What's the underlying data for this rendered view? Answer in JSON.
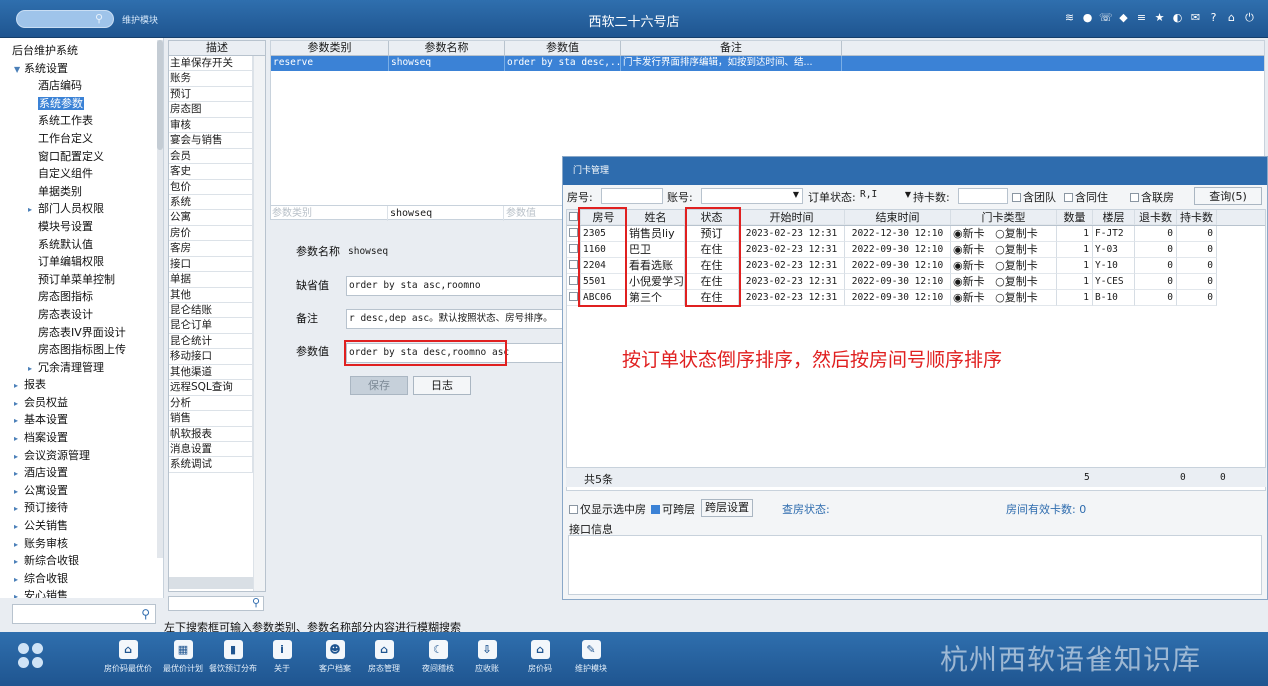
{
  "top_bar": {
    "search_icon": "search-icon",
    "module_label": "维护模块",
    "hotel_title": "西软二十六号店",
    "icons": [
      "wifi-icon",
      "message-icon",
      "phone-icon",
      "user-icon",
      "menu-icon",
      "star-icon",
      "contrast-icon",
      "mail-icon",
      "help-icon",
      "home-icon",
      "power-icon"
    ]
  },
  "nav": {
    "items": [
      {
        "label": "后台维护系统",
        "level": 0,
        "arrow": ""
      },
      {
        "label": "系统设置",
        "level": 1,
        "arrow": "▼"
      },
      {
        "label": "酒店编码",
        "level": 2,
        "arrow": ""
      },
      {
        "label": "系统参数",
        "level": 2,
        "arrow": "",
        "selected": true
      },
      {
        "label": "系统工作表",
        "level": 2,
        "arrow": ""
      },
      {
        "label": "工作台定义",
        "level": 2,
        "arrow": ""
      },
      {
        "label": "窗口配置定义",
        "level": 2,
        "arrow": ""
      },
      {
        "label": "自定义组件",
        "level": 2,
        "arrow": ""
      },
      {
        "label": "单据类别",
        "level": 2,
        "arrow": ""
      },
      {
        "label": "部门人员权限",
        "level": 2,
        "arrow": "▸"
      },
      {
        "label": "模块号设置",
        "level": 2,
        "arrow": ""
      },
      {
        "label": "系统默认值",
        "level": 2,
        "arrow": ""
      },
      {
        "label": "订单编辑权限",
        "level": 2,
        "arrow": ""
      },
      {
        "label": "预订单菜单控制",
        "level": 2,
        "arrow": ""
      },
      {
        "label": "房态图指标",
        "level": 2,
        "arrow": ""
      },
      {
        "label": "房态表设计",
        "level": 2,
        "arrow": ""
      },
      {
        "label": "房态表IV界面设计",
        "level": 2,
        "arrow": ""
      },
      {
        "label": "房态图指标图上传",
        "level": 2,
        "arrow": ""
      },
      {
        "label": "冗余清理管理",
        "level": 2,
        "arrow": "▸"
      },
      {
        "label": "报表",
        "level": 1,
        "arrow": "▸"
      },
      {
        "label": "会员权益",
        "level": 1,
        "arrow": "▸"
      },
      {
        "label": "基本设置",
        "level": 1,
        "arrow": "▸"
      },
      {
        "label": "档案设置",
        "level": 1,
        "arrow": "▸"
      },
      {
        "label": "会议资源管理",
        "level": 1,
        "arrow": "▸"
      },
      {
        "label": "酒店设置",
        "level": 1,
        "arrow": "▸"
      },
      {
        "label": "公寓设置",
        "level": 1,
        "arrow": "▸"
      },
      {
        "label": "预订接待",
        "level": 1,
        "arrow": "▸"
      },
      {
        "label": "公关销售",
        "level": 1,
        "arrow": "▸"
      },
      {
        "label": "账务审核",
        "level": 1,
        "arrow": "▸"
      },
      {
        "label": "新综合收银",
        "level": 1,
        "arrow": "▸"
      },
      {
        "label": "综合收银",
        "level": 1,
        "arrow": "▸"
      },
      {
        "label": "安心销售",
        "level": 1,
        "arrow": "▸"
      }
    ]
  },
  "desc_list": {
    "header": "描述",
    "items": [
      "主单保存开关",
      "账务",
      "预订",
      "房态图",
      "审核",
      "宴会与销售",
      "会员",
      "客史",
      "包价",
      "系统",
      "公寓",
      "房价",
      "客房",
      "接口",
      "单据",
      "其他",
      "昆仑结账",
      "昆仑订单",
      "昆仑统计",
      "移动接口",
      "其他渠道",
      "远程SQL查询",
      "分析",
      "销售",
      "帆软报表",
      "消息设置",
      "系统调试"
    ]
  },
  "param_grid": {
    "headers": [
      "参数类别",
      "参数名称",
      "参数值",
      "备注"
    ],
    "row": [
      "reserve",
      "showseq",
      "order by sta desc,...",
      "门卡发行界面排序编辑，如按到达时间、结..."
    ],
    "filter": [
      "参数类别",
      "showseq",
      "参数值"
    ]
  },
  "form": {
    "name_label": "参数名称",
    "name_value": "showseq",
    "default_label": "缺省值",
    "default_value": "order by sta asc,roomno",
    "remark_label": "备注",
    "remark_value": "r desc,dep asc。默认按照状态、房号排序。",
    "value_label": "参数值",
    "value_value": "order by sta desc,roomno asc",
    "save_label": "保存",
    "log_label": "日志"
  },
  "hint": "左下搜索框可输入参数类别、参数名称部分内容进行模糊搜索",
  "dialog": {
    "title": "门卡管理",
    "room_label": "房号:",
    "account_label": "账号:",
    "order_status_label": "订单状态:",
    "order_status_value": "R,I",
    "card_count_label": "持卡数:",
    "group_label": "含团队",
    "cohabit_label": "含同住",
    "linked_label": "含联房",
    "query_label": "查询(5)",
    "headers": [
      "房号",
      "姓名",
      "状态",
      "开始时间",
      "结束时间",
      "门卡类型",
      "数量",
      "楼层",
      "退卡数",
      "持卡数"
    ],
    "rows": [
      {
        "room": "2305",
        "name": "销售员liy",
        "status": "预订",
        "start": "2023-02-23 12:31",
        "end": "2022-12-30 12:10",
        "new_card": "新卡",
        "copy_card": "复制卡",
        "qty": "1",
        "floor": "F-JT2",
        "return": "0",
        "hold": "0"
      },
      {
        "room": "1160",
        "name": "巴卫",
        "status": "在住",
        "start": "2023-02-23 12:31",
        "end": "2022-09-30 12:10",
        "new_card": "新卡",
        "copy_card": "复制卡",
        "qty": "1",
        "floor": "Y-03",
        "return": "0",
        "hold": "0"
      },
      {
        "room": "2204",
        "name": "看看选账",
        "status": "在住",
        "start": "2023-02-23 12:31",
        "end": "2022-09-30 12:10",
        "new_card": "新卡",
        "copy_card": "复制卡",
        "qty": "1",
        "floor": "Y-10",
        "return": "0",
        "hold": "0"
      },
      {
        "room": "5501",
        "name": "小倪爱学习",
        "status": "在住",
        "start": "2023-02-23 12:31",
        "end": "2022-09-30 12:10",
        "new_card": "新卡",
        "copy_card": "复制卡",
        "qty": "1",
        "floor": "Y-CES",
        "return": "0",
        "hold": "0"
      },
      {
        "room": "ABC06",
        "name": "第三个",
        "status": "在住",
        "start": "2023-02-23 12:31",
        "end": "2022-09-30 12:10",
        "new_card": "新卡",
        "copy_card": "复制卡",
        "qty": "1",
        "floor": "B-10",
        "return": "0",
        "hold": "0"
      }
    ],
    "footer_count": "共5条",
    "footer_qty": "5",
    "footer_return": "0",
    "footer_hold": "0",
    "only_selected_label": "仅显示选中房",
    "cross_floor_label": "可跨层",
    "cross_floor_btn": "跨层设置",
    "check_status_label": "查房状态:",
    "valid_cards_label": "房间有效卡数: 0",
    "iface_label": "接口信息"
  },
  "annotation": "按订单状态倒序排序，然后按房间号顺序排序",
  "bottom_bar": {
    "items": [
      {
        "label": "房价码最优价",
        "icon": "house-icon",
        "glyph": "⌂"
      },
      {
        "label": "最优价计划",
        "icon": "calendar-icon",
        "glyph": "▦"
      },
      {
        "label": "餐饮预订分布",
        "icon": "bar-chart-icon",
        "glyph": "▮"
      },
      {
        "label": "关于",
        "icon": "info-icon",
        "glyph": "i"
      },
      {
        "label": "客户档案",
        "icon": "contact-icon",
        "glyph": "☻"
      },
      {
        "label": "房态管理",
        "icon": "room-status-icon",
        "glyph": "⌂"
      },
      {
        "label": "夜间稽核",
        "icon": "night-audit-icon",
        "glyph": "☾"
      },
      {
        "label": "应收账",
        "icon": "receivable-icon",
        "glyph": "⇩"
      },
      {
        "label": "房价码",
        "icon": "rate-code-icon",
        "glyph": "⌂"
      },
      {
        "label": "维护模块",
        "icon": "maintenance-icon",
        "glyph": "✎"
      }
    ],
    "watermark": "杭州西软语雀知识库"
  }
}
